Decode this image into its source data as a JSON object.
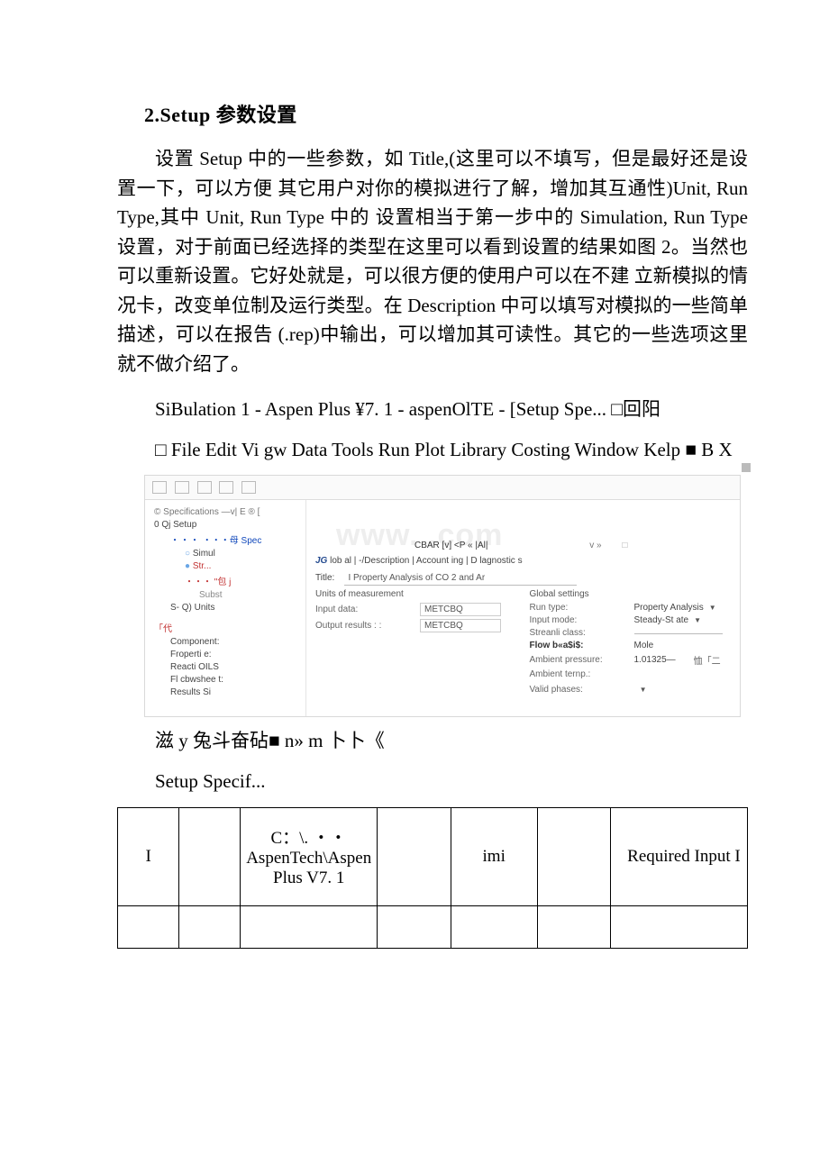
{
  "doc": {
    "heading": "2.Setup 参数设置",
    "para1": "设置 Setup 中的一些参数，如 Title,(这里可以不填写，但是最好还是设置一下，可以方便 其它用户对你的模拟进行了解，增加其互通性)Unit, Run Type,其中 Unit, Run Type 中的 设置相当于第一步中的 Simulation, Run Type 设置，对于前面已经选择的类型在这里可以看到设置的结果如图 2。当然也可以重新设置。它好处就是，可以很方便的使用户可以在不建 立新模拟的情况卡，改变单位制及运行类型。在 Description 中可以填写对模拟的一些简单 描述，可以在报告 (.rep)中输出，可以增加其可读性。其它的一些选项这里就不做介绍了。",
    "line_title": "SiBulation 1 - Aspen Plus ¥7. 1 - aspenOlTE - [Setup Spe... □回阳",
    "line_menu": "□ File Edit Vi gw Data Tools Run Plot Library Costing Window Kelp ■ B X",
    "ocr_line1": "滋 y 兔斗奋砧■ n» m 卜卜《",
    "ocr_line2": "Setup Specif..."
  },
  "shot": {
    "crumb_left": "© Specifications  —v|  E ® [",
    "crumb_mid": "CBAR [v] <P « |Al|",
    "crumb_v": "v »",
    "tabs": {
      "jg": "JG",
      "rest": " lob al | -/Description  |  Account ing  |  D lagnostic s"
    },
    "title_label": "Title:",
    "title_value": "I Property Analysis of CO 2 and Ar",
    "units_header": "Units of measurement",
    "input_data_label": "Input data:",
    "input_data_value": "METCBQ",
    "output_results_label": "Output results : :",
    "output_results_value": "METCBQ",
    "global_header": "Global settings",
    "run_type_label": "Run type:",
    "run_type_value": "Property Analysis",
    "input_mode_label": "Input mode:",
    "input_mode_value": "Steady-St ate",
    "stream_class_label": "Streanli class:",
    "flow_basis_label": "Flow b«a$i$:",
    "flow_basis_value": "Mole",
    "ambient_pressure_label": "Ambient pressure:",
    "ambient_pressure_value": "1.01325—",
    "ambient_pressure_unit": "恤「二",
    "ambient_temp_label": "Ambient ternp.:",
    "valid_phases_label": "Valid phases:",
    "watermark": "www.        .com",
    "tree": {
      "n1": "0 Qj Setup",
      "n2": "・・・母 Spec",
      "n3": "Simul",
      "n4": "Str...",
      "n5": "\"包 j",
      "n6": "Subst",
      "n7": "S- Q) Units",
      "n8": "「代",
      "n9": "Component:",
      "n10": "Froperti    e:",
      "n11": "Reacti    OILS",
      "n12": "Fl cbwshee t:",
      "n13": "Results Si"
    }
  },
  "table": {
    "r1c1": "I",
    "r1c3": "C：\\. ・・AspenTech\\Aspen Plus V7. 1",
    "r1c5": "imi",
    "r1c7": "Required Input I"
  }
}
